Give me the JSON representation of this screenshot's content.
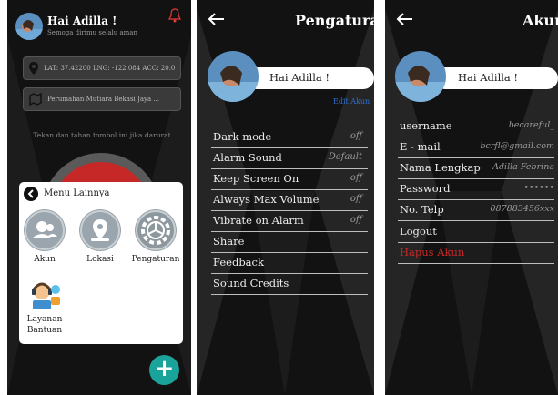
{
  "home": {
    "greeting": "Hai Adilla !",
    "subtitle": "Semoga dirimu selalu aman",
    "location": "LAT: 37.42200 LNG: -122.084 ACC: 20.0",
    "address": "Perumahan Mutiara Bekasi Jaya ...",
    "instruction": "Tekan dan tahan tombol ini jika darurat",
    "menu_title": "Menu Lainnya",
    "menu_items": [
      {
        "label": "Akun",
        "icon": "user-icon"
      },
      {
        "label": "Lokasi",
        "icon": "location-pin-icon"
      },
      {
        "label": "Pengaturan",
        "icon": "gear-icon"
      }
    ],
    "help_label_1": "Layanan",
    "help_label_2": "Bantuan",
    "fab_label": "+"
  },
  "settings": {
    "title": "Pengaturan",
    "greeting": "Hai Adilla !",
    "edit_link": "Edit Akun",
    "rows": [
      {
        "label": "Dark mode",
        "value": "off"
      },
      {
        "label": "Alarm Sound",
        "value": "Default"
      },
      {
        "label": "Keep Screen On",
        "value": "off"
      },
      {
        "label": "Always Max Volume",
        "value": "off"
      },
      {
        "label": "Vibrate on Alarm",
        "value": "off"
      },
      {
        "label": "Share",
        "value": ""
      },
      {
        "label": "Feedback",
        "value": ""
      },
      {
        "label": "Sound Credits",
        "value": ""
      }
    ]
  },
  "account": {
    "title": "Akun",
    "greeting": "Hai Adilla !",
    "rows": [
      {
        "label": "username",
        "value": "becareful_"
      },
      {
        "label": "E - mail",
        "value": "bcrfl@gmail.com"
      },
      {
        "label": "Nama Lengkap",
        "value": "Adilla Febrina"
      },
      {
        "label": "Password",
        "value": "••••••"
      },
      {
        "label": "No. Telp",
        "value": "087883456xxx"
      },
      {
        "label": "Logout",
        "value": ""
      }
    ],
    "delete_label": "Hapus Akun"
  },
  "colors": {
    "background": "#121212",
    "accent_teal": "#1aa39a",
    "danger": "#c62828",
    "link_blue": "#2f6fd0"
  }
}
